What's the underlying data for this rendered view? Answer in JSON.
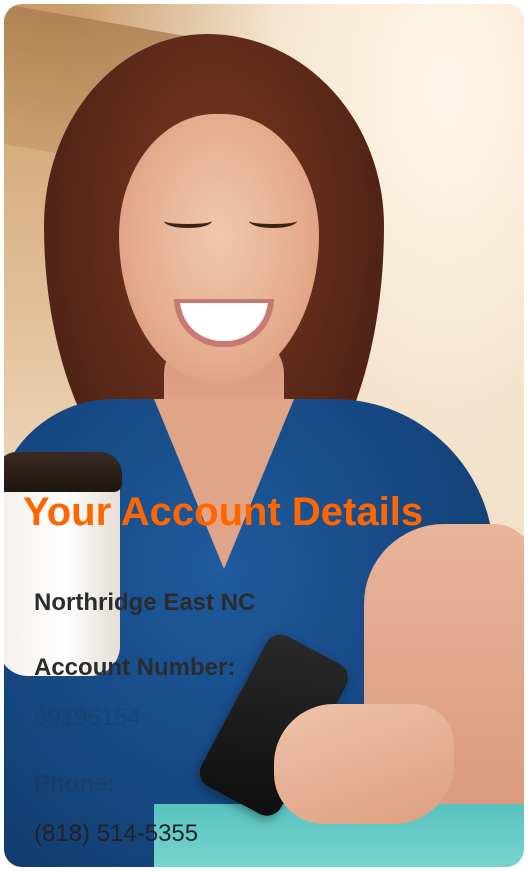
{
  "card": {
    "title": "Your Account Details",
    "location_name": "Northridge East NC",
    "account_number_label": "Account Number:",
    "account_number": "59196154",
    "phone_label": "Phone:",
    "phone": "(818) 514-5355"
  },
  "colors": {
    "accent": "#ff6600",
    "text_dark": "#2b2b2b"
  },
  "photo": {
    "subject": "woman-with-coffee-and-phone-photo"
  }
}
